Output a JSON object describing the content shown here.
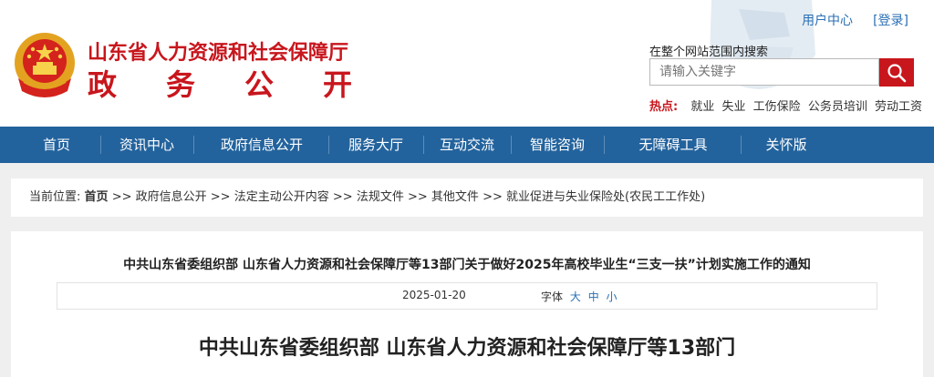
{
  "header": {
    "title": "山东省人力资源和社会保障厅",
    "subtitle_chars": [
      "政",
      "务",
      "公",
      "开"
    ],
    "top_links": [
      "用户中心",
      "[登录]"
    ],
    "search": {
      "label": "在整个网站范围内搜索",
      "placeholder": "请输入关键字"
    },
    "hot": {
      "label": "热点:",
      "keywords": [
        "就业",
        "失业",
        "工伤保险",
        "公务员培训",
        "劳动工资"
      ]
    },
    "brand_color": "#c8161d"
  },
  "nav": {
    "items": [
      "首页",
      "资讯中心",
      "政府信息公开",
      "服务大厅",
      "互动交流",
      "智能咨询",
      "无障碍工具",
      "关怀版"
    ],
    "color": "#23639d"
  },
  "breadcrumb": {
    "prefix": "当前位置:",
    "items": [
      "首页",
      "政府信息公开",
      "法定主动公开内容",
      "法规文件",
      "其他文件",
      "就业促进与失业保险处(农民工工作处)"
    ],
    "separator": ">>"
  },
  "article": {
    "title": "中共山东省委组织部 山东省人力资源和社会保障厅等13部门关于做好2025年高校毕业生“三支一扶”计划实施工作的通知",
    "date": "2025-01-20",
    "font_label": "字体",
    "font_sizes": [
      "大",
      "中",
      "小"
    ],
    "doc_heading": "中共山东省委组织部  山东省人力资源和社会保障厅等13部门"
  }
}
